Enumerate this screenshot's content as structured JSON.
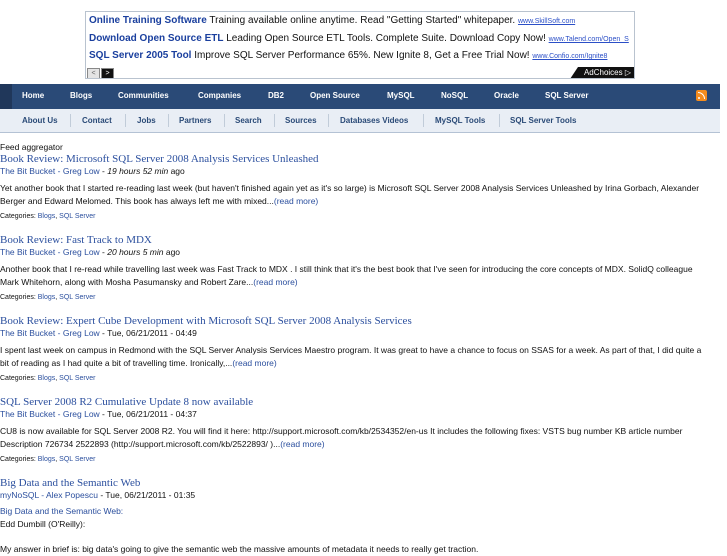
{
  "ads": [
    {
      "title": "Online Training Software",
      "text": "Training available online anytime. Read \"Getting Started\" whitepaper.",
      "url": "www.SkillSoft.com"
    },
    {
      "title": "Download Open Source ETL",
      "text": "Leading Open Source ETL Tools. Complete Suite. Download Copy Now!",
      "url": "www.Talend.com/Open_S"
    },
    {
      "title": "SQL Server 2005 Tool",
      "text": "Improve SQL Server Performance 65%. New Ignite 8, Get a Free Trial Now!",
      "url": "www.Confio.com/Ignite8"
    }
  ],
  "ad_controls": {
    "prev": "<",
    "next": ">",
    "adchoices": "AdChoices ▷"
  },
  "nav_primary": [
    "Home",
    "Blogs",
    "Communities",
    "Companies",
    "DB2",
    "Open Source",
    "MySQL",
    "NoSQL",
    "Oracle",
    "SQL Server"
  ],
  "nav_secondary": [
    "About Us",
    "Contact",
    "Jobs",
    "Partners",
    "Search",
    "Sources",
    "Databases Videos",
    "MySQL Tools",
    "SQL Server Tools"
  ],
  "icons": {
    "rss": "rss-icon"
  },
  "colors": {
    "nav_primary_bg": "#2a4a77",
    "nav_secondary_bg": "#e9eef5",
    "link": "#2b4f9e",
    "rss": "#f48c1e"
  },
  "feed_label": "Feed aggregator",
  "posts": [
    {
      "title": "Book Review: Microsoft SQL Server 2008 Analysis Services Unleashed",
      "source": "The Bit Bucket - Greg Low",
      "sep": " - ",
      "time": "19 hours 52 min",
      "time_suffix": " ago",
      "body": "Yet another book that I started re-reading last week (but haven't finished again yet as it's so large) is Microsoft SQL Server 2008 Analysis Services Unleashed by Irina Gorbach, Alexander Berger and Edward Melomed. This book has always left me with mixed...",
      "more": "(read more)",
      "cats_label": "Categories: ",
      "cats": [
        "Blogs",
        "SQL Server"
      ]
    },
    {
      "title": "Book Review: Fast Track to MDX",
      "source": "The Bit Bucket - Greg Low",
      "sep": " - ",
      "time": "20 hours 5 min",
      "time_suffix": " ago",
      "body": "Another book that I re-read while travelling last week was Fast Track to MDX . I still think that it's the best book that I've seen for introducing the core concepts of MDX. SolidQ colleague Mark Whitehorn, along with Mosha Pasumansky and Robert Zare...",
      "more": "(read more)",
      "cats_label": "Categories: ",
      "cats": [
        "Blogs",
        "SQL Server"
      ]
    },
    {
      "title": "Book Review: Expert Cube Development with Microsoft SQL Server 2008 Analysis Services",
      "source": "The Bit Bucket - Greg Low",
      "sep": " - ",
      "time": "Tue, 06/21/2011 - 04:49",
      "time_suffix": "",
      "body": "I spent last week on campus in Redmond with the SQL Server Analysis Services Maestro program. It was great to have a chance to focus on SSAS for a week. As part of that, I did quite a bit of reading as I had quite a bit of travelling time. Ironically,...",
      "more": "(read more)",
      "cats_label": "Categories: ",
      "cats": [
        "Blogs",
        "SQL Server"
      ]
    },
    {
      "title": "SQL Server 2008 R2 Cumulative Update 8 now available",
      "source": "The Bit Bucket - Greg Low",
      "sep": " - ",
      "time": "Tue, 06/21/2011 - 04:37",
      "time_suffix": "",
      "body": "CU8 is now available for SQL Server 2008 R2. You will find it here: http://support.microsoft.com/kb/2534352/en-us It includes the following fixes: VSTS bug number KB article number Description 726734 2522893 (http://support.microsoft.com/kb/2522893/ )...",
      "more": "(read more)",
      "cats_label": "Categories: ",
      "cats": [
        "Blogs",
        "SQL Server"
      ]
    },
    {
      "title": "Big Data and the Semantic Web",
      "source": "myNoSQL - Alex Popescu",
      "sep": " - ",
      "time": "Tue, 06/21/2011 - 01:35",
      "time_suffix": "",
      "link_line": "Big Data and the Semantic Web:",
      "author_line": "Edd Dumbill (O'Reilly):",
      "body": "My answer in brief is: big data's going to give the semantic web the massive amounts of metadata it needs to really get traction."
    }
  ]
}
